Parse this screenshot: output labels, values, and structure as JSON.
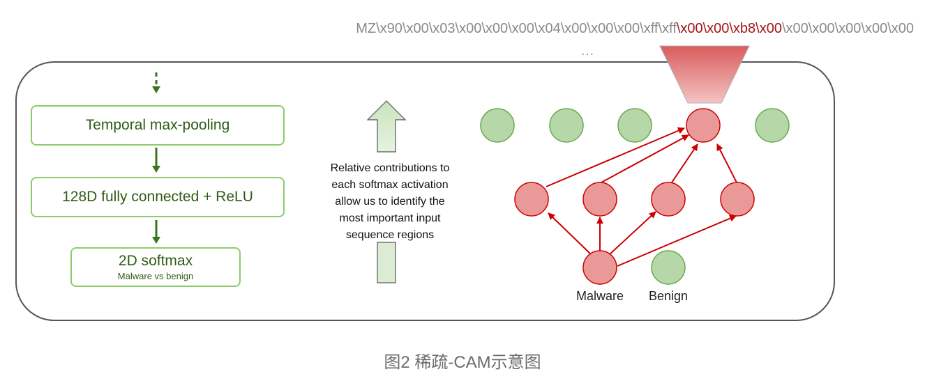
{
  "byte_sequence": {
    "before": "MZ\\x90\\x00\\x03\\x00\\x00\\x00\\x04\\x00\\x00\\x00\\xff\\xff",
    "highlighted": "\\x00\\x00\\xb8\\x00",
    "after": "\\x00\\x00\\x00\\x00\\x00"
  },
  "ellipsis": "…",
  "pipeline": {
    "pool_label": "Temporal max-pooling",
    "fc_label": "128D fully connected + ReLU",
    "softmax_label": "2D softmax",
    "softmax_sublabel": "Malware vs benign"
  },
  "explanation": {
    "lines": [
      "Relative contributions to",
      "each softmax activation",
      "allow us to identify the",
      "most important input",
      "sequence regions"
    ]
  },
  "network": {
    "output_labels": [
      "Malware",
      "Benign"
    ]
  },
  "colors": {
    "green_fill": "#b6d7a8",
    "green_stroke": "#6aa84f",
    "red_fill": "#ea9999",
    "red_stroke": "#cc0000",
    "arrow_green": "#38761d",
    "highlight_text": "#a31515"
  },
  "caption": "图2 稀疏-CAM示意图"
}
